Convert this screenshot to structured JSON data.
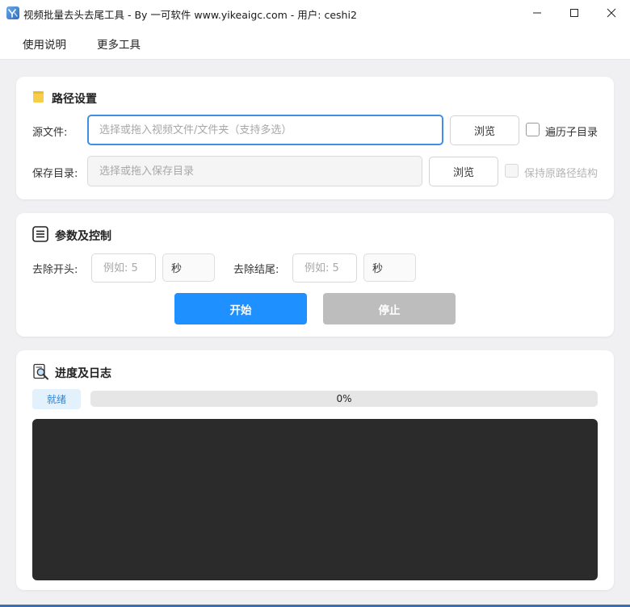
{
  "window": {
    "title": "视频批量去头去尾工具 - By 一可软件 www.yikeaigc.com - 用户: ceshi2",
    "icon": "app-logo-icon",
    "controls": [
      "minimize-icon",
      "maximize-icon",
      "close-icon"
    ]
  },
  "menu": {
    "items": [
      {
        "label": "使用说明"
      },
      {
        "label": "更多工具"
      }
    ]
  },
  "path_settings": {
    "title": "路径设置",
    "icon": "folder-icon",
    "source": {
      "label": "源文件:",
      "value": "",
      "placeholder": "选择或拖入视频文件/文件夹（支持多选）",
      "browse_label": "浏览",
      "checkbox_label": "遍历子目录",
      "checkbox_checked": false
    },
    "output": {
      "label": "保存目录:",
      "value": "",
      "placeholder": "选择或拖入保存目录",
      "browse_label": "浏览",
      "checkbox_label": "保持原路径结构",
      "checkbox_checked": false,
      "checkbox_disabled": true
    }
  },
  "params": {
    "title": "参数及控制",
    "icon": "list-icon",
    "head": {
      "label": "去除开头:",
      "value": "",
      "placeholder": "例如: 5",
      "unit": "秒"
    },
    "tail": {
      "label": "去除结尾:",
      "value": "",
      "placeholder": "例如: 5",
      "unit": "秒"
    },
    "start_label": "开始",
    "stop_label": "停止",
    "start_color": "#1e90ff",
    "stop_color": "#bdbdbd"
  },
  "progress": {
    "title": "进度及日志",
    "icon": "search-document-icon",
    "status": "就绪",
    "percent": 0,
    "percent_text": "0%",
    "log_text": ""
  }
}
